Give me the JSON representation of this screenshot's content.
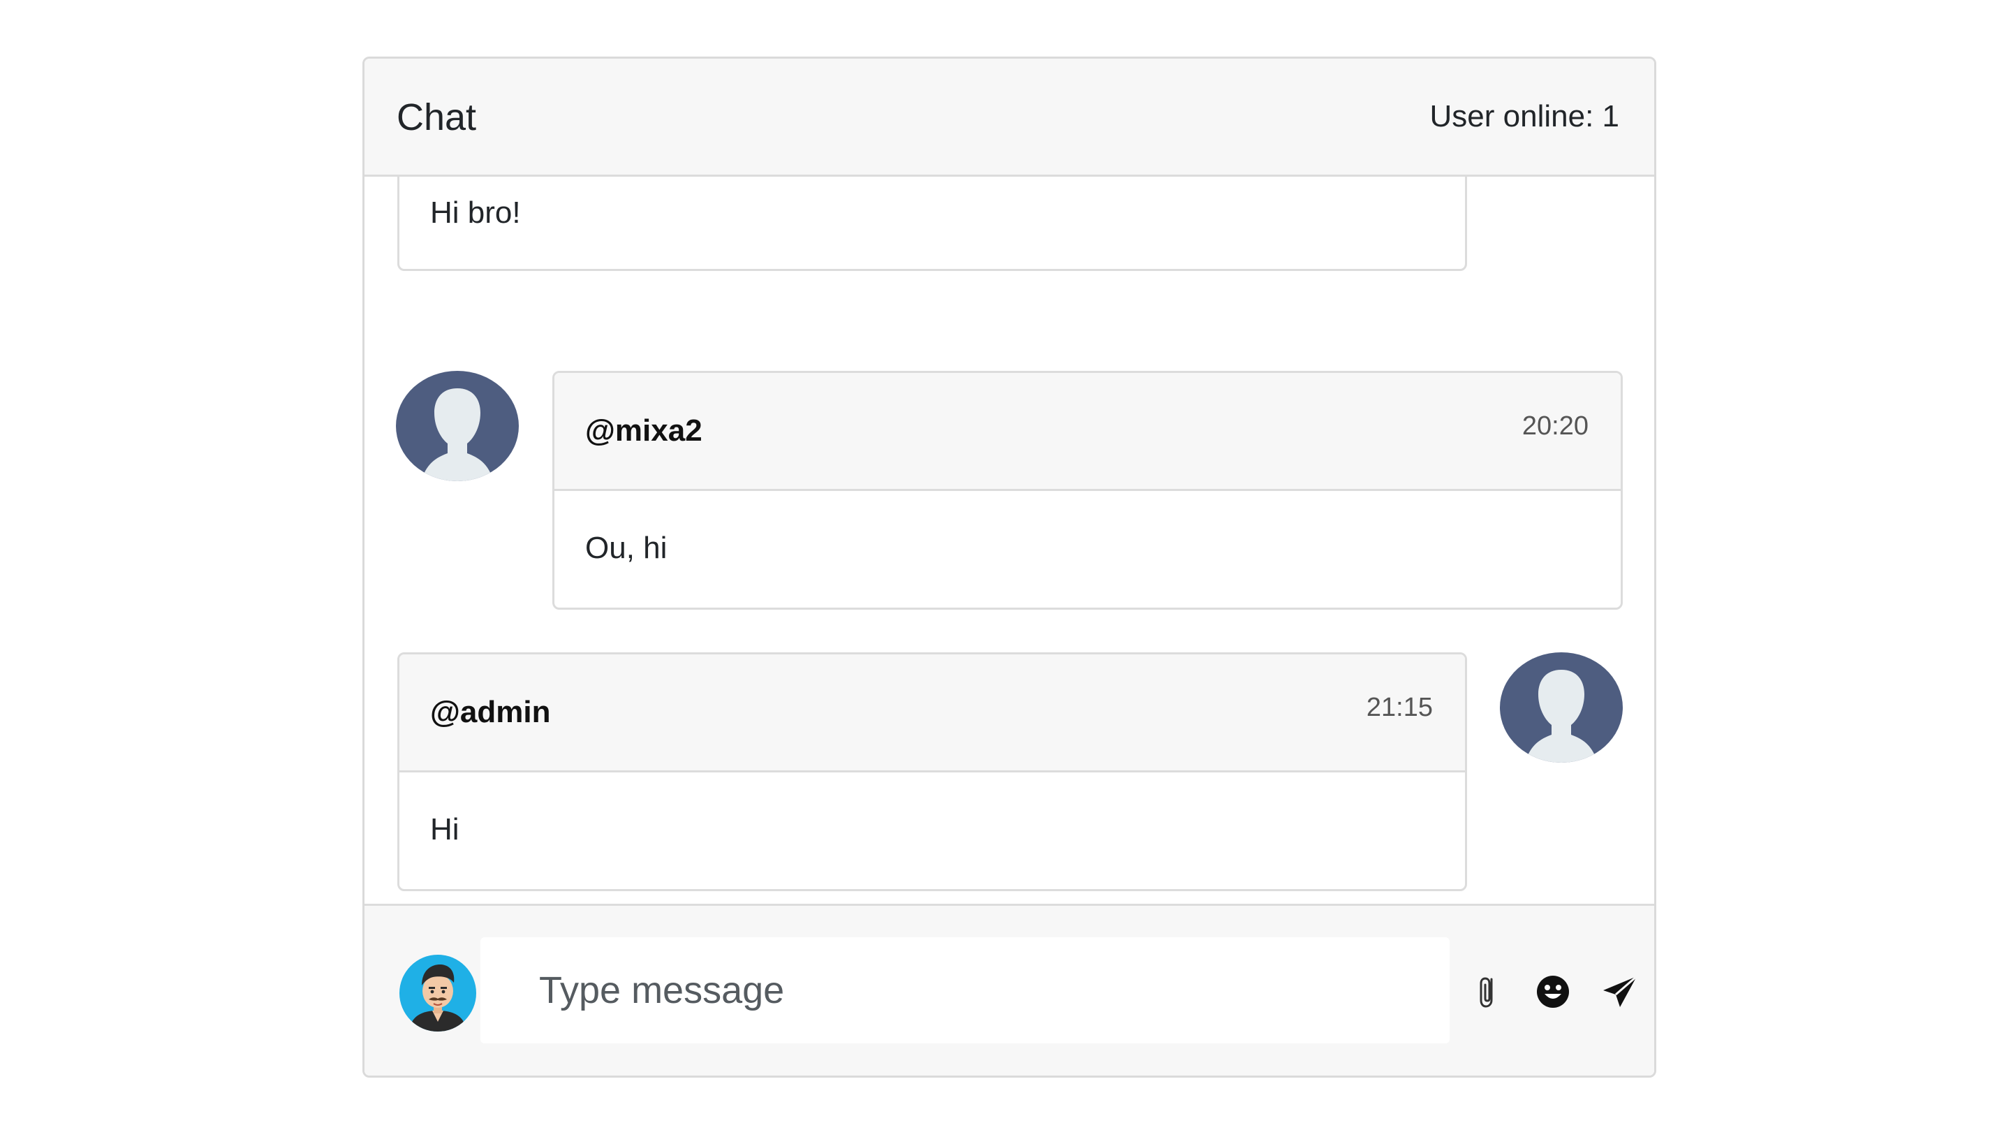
{
  "header": {
    "title": "Chat",
    "online": "User online: 1"
  },
  "messages": [
    {
      "user": "",
      "time": "",
      "text": "Hi bro!"
    },
    {
      "user": "@mixa2",
      "time": "20:20",
      "text": "Ou, hi"
    },
    {
      "user": "@admin",
      "time": "21:15",
      "text": "Hi"
    }
  ],
  "footer": {
    "placeholder": "Type message",
    "icons": [
      "paperclip-icon",
      "smile-icon",
      "send-icon"
    ]
  },
  "colors": {
    "avatar_bg": "#4e5d80",
    "avatar_figure": "#e6ecef",
    "header_bg": "#f7f7f7",
    "border": "#dcdcdc"
  }
}
